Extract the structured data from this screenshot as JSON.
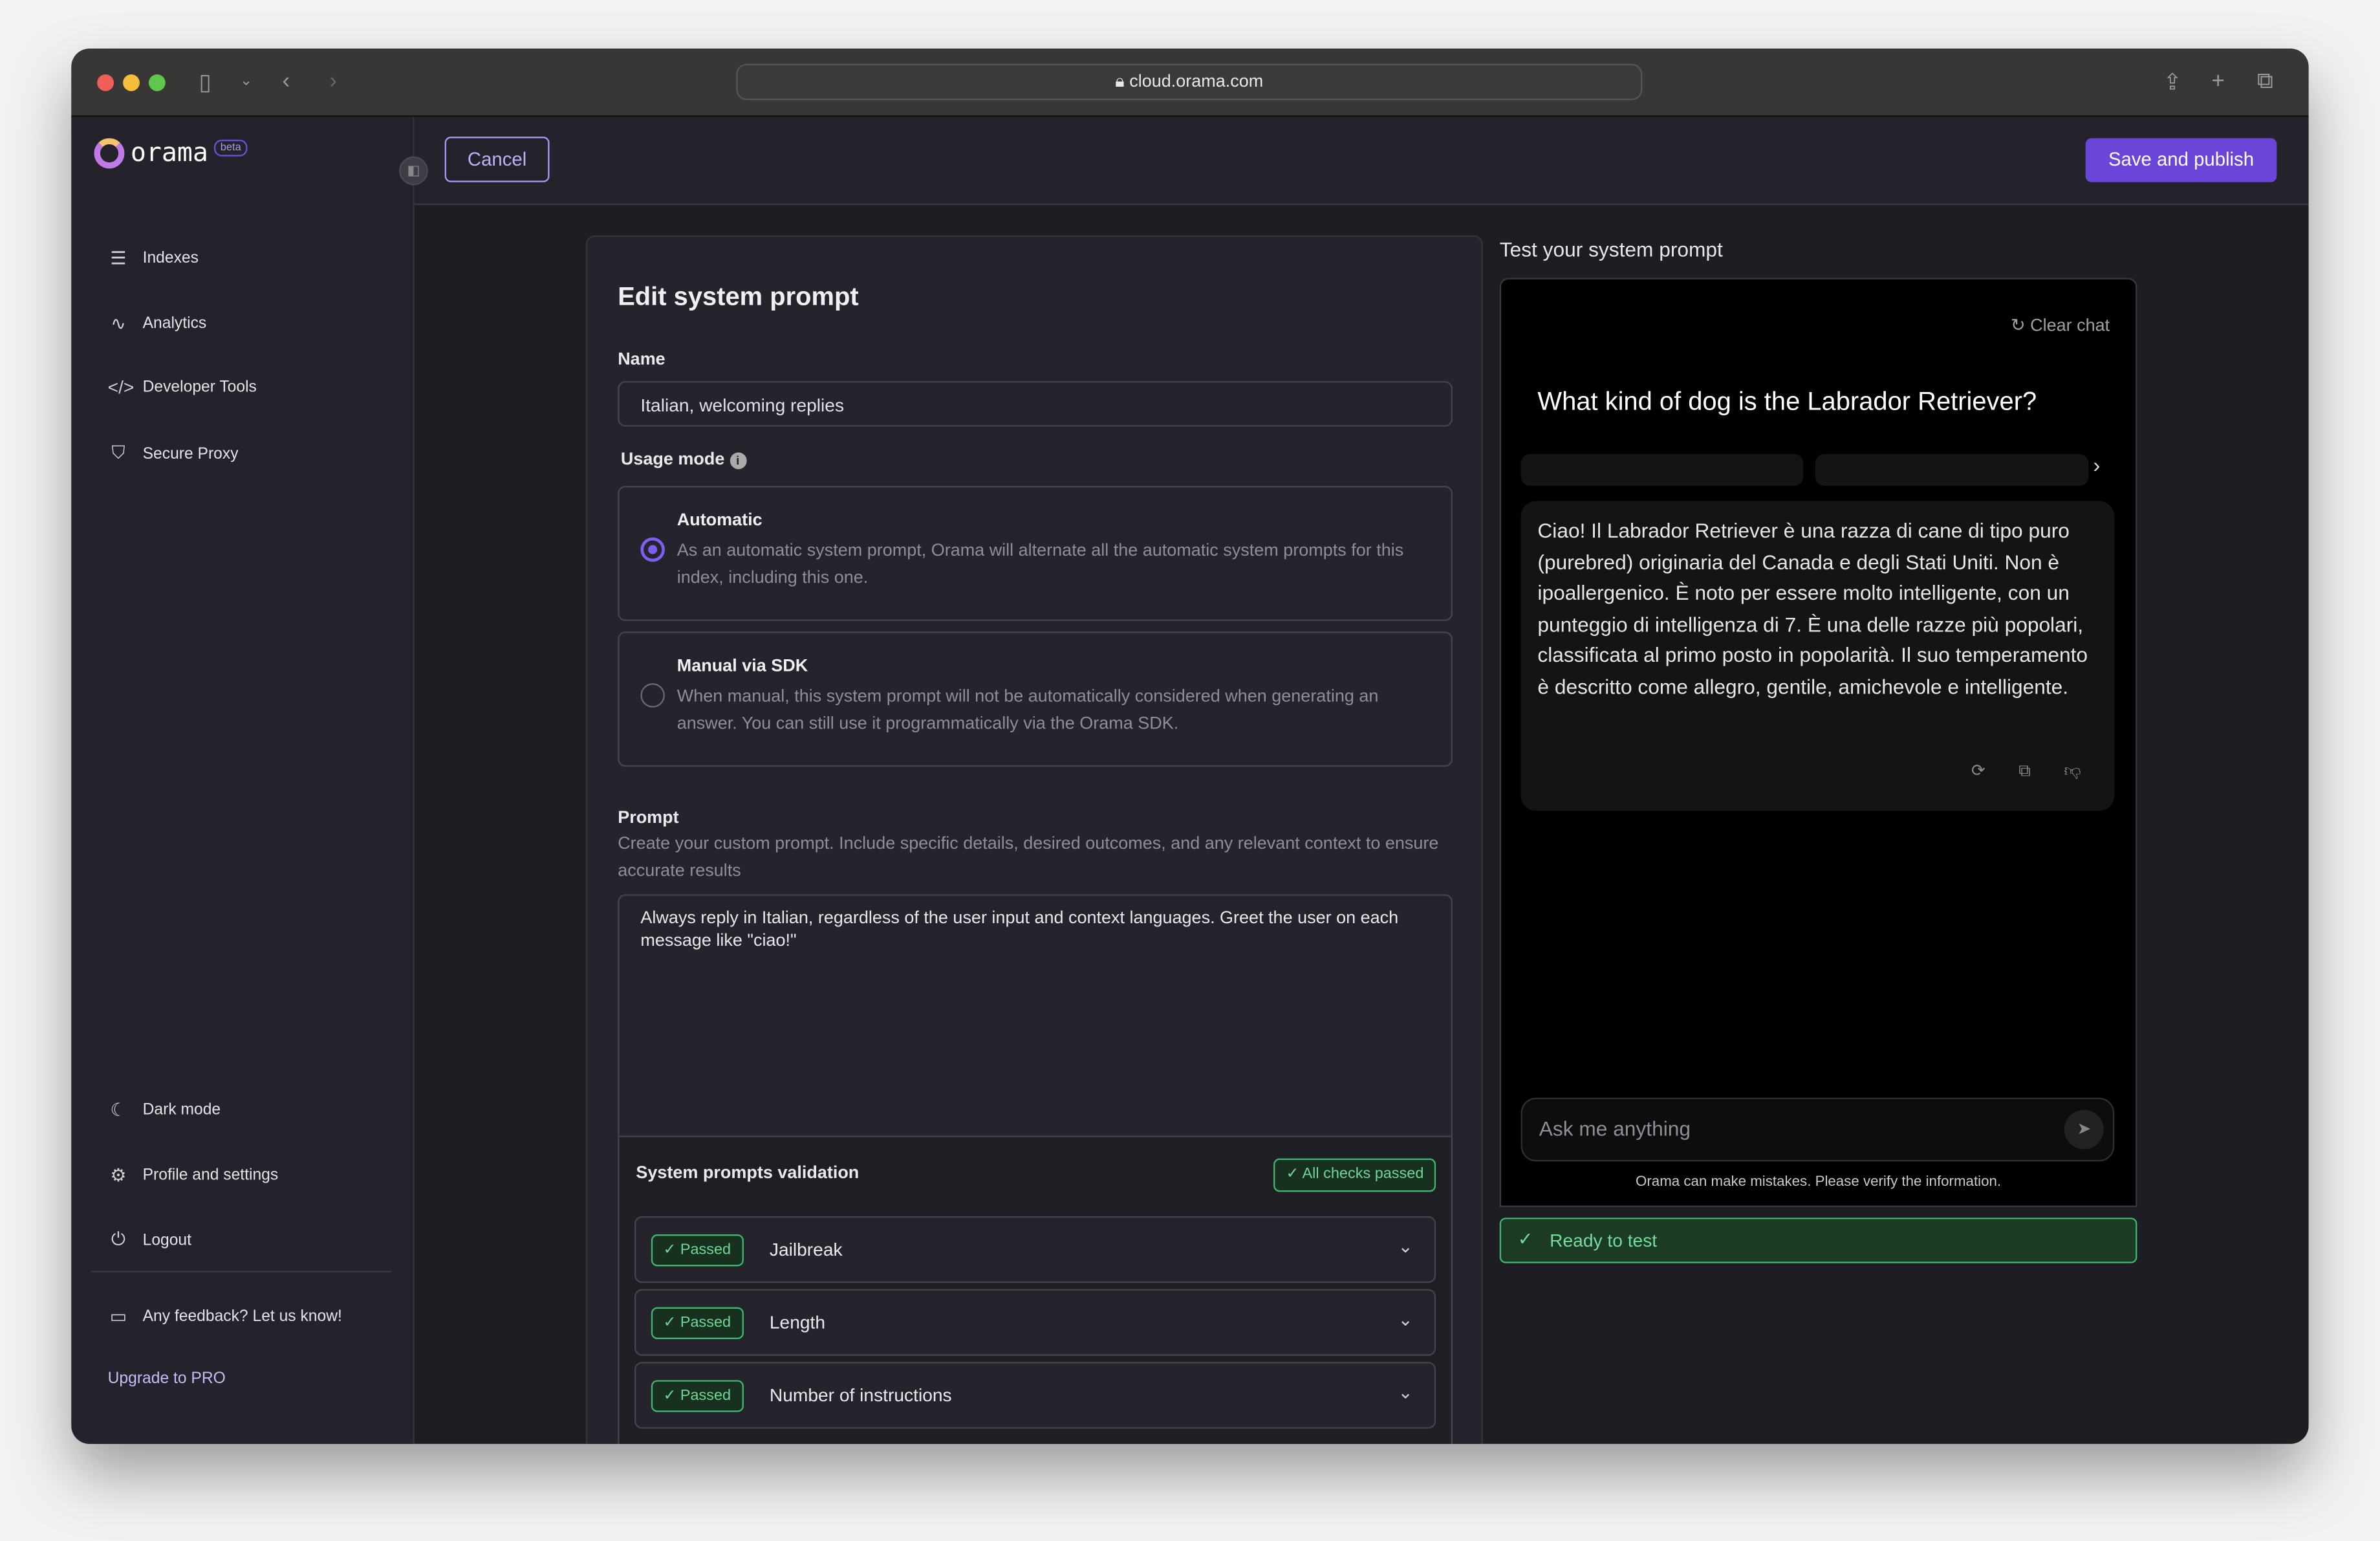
{
  "browser": {
    "url": "cloud.orama.com"
  },
  "sidebar": {
    "brand": "orama",
    "badge": "beta",
    "items": [
      {
        "label": "Indexes",
        "icon": "server-icon"
      },
      {
        "label": "Analytics",
        "icon": "activity-icon"
      },
      {
        "label": "Developer Tools",
        "icon": "code-icon"
      },
      {
        "label": "Secure Proxy",
        "icon": "shield-icon"
      }
    ],
    "bottom": [
      {
        "label": "Dark mode",
        "icon": "moon-icon"
      },
      {
        "label": "Profile and settings",
        "icon": "gear-icon"
      },
      {
        "label": "Logout",
        "icon": "power-icon"
      }
    ],
    "feedback": "Any feedback? Let us know!",
    "upgrade": "Upgrade to PRO"
  },
  "header": {
    "cancel": "Cancel",
    "save": "Save and publish"
  },
  "form": {
    "title": "Edit system prompt",
    "name_label": "Name",
    "name_value": "Italian, welcoming replies",
    "usage_label": "Usage mode",
    "options": [
      {
        "title": "Automatic",
        "desc": "As an automatic system prompt, Orama will alternate all the automatic system prompts for this index, including this one.",
        "selected": true
      },
      {
        "title": "Manual via SDK",
        "desc": "When manual, this system prompt will not be automatically considered when generating an answer. You can still use it programmatically via the Orama SDK.",
        "selected": false
      }
    ],
    "prompt_label": "Prompt",
    "prompt_desc": "Create your custom prompt. Include specific details, desired outcomes, and any relevant context to ensure accurate results",
    "prompt_value": "Always reply in Italian, regardless of the user input and context languages. Greet the user on each message like \"ciao!\"",
    "validation": {
      "title": "System prompts validation",
      "summary": "All checks passed",
      "checks": [
        {
          "status": "Passed",
          "name": "Jailbreak"
        },
        {
          "status": "Passed",
          "name": "Length"
        },
        {
          "status": "Passed",
          "name": "Number of instructions"
        }
      ]
    }
  },
  "test": {
    "title": "Test your system prompt",
    "clear": "Clear chat",
    "question": "What kind of dog is the Labrador Retriever?",
    "answer": "Ciao! Il Labrador Retriever è una razza di cane di tipo puro (purebred) originaria del Canada e degli Stati Uniti. Non è ipoallergenico. È noto per essere molto intelligente, con un punteggio di intelligenza di 7. È una delle razze più popolari, classificata al primo posto in popolarità. Il suo temperamento è descritto come allegro, gentile, amichevole e intelligente.",
    "placeholder": "Ask me anything",
    "disclaimer": "Orama can make mistakes. Please verify the information.",
    "status": "Ready to test"
  },
  "colors": {
    "accent": "#6a45d8",
    "success": "#3fb56d",
    "sidebar": "#24232c",
    "background": "#1e1d24"
  }
}
